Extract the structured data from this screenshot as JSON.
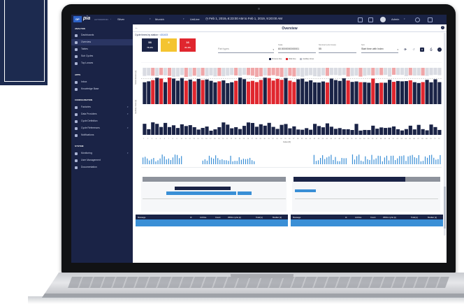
{
  "topbar": {
    "logo_short": "DP",
    "logo_brand": "pia",
    "logo_sub": "AUTOMATION",
    "filters": [
      {
        "value": "Silver"
      },
      {
        "value": "Munich"
      },
      {
        "value": "UniLine"
      }
    ],
    "date_range": "Feb 1, 2019, 6:23:00 AM to Feb 1, 2019, 9:20:00 AM",
    "user": "Admin"
  },
  "sidebar": {
    "sections": [
      {
        "title": "ANALYSIS",
        "items": [
          {
            "label": "Dashboards"
          },
          {
            "label": "Overview"
          },
          {
            "label": "Tables"
          },
          {
            "label": "Sub Cycles"
          },
          {
            "label": "Top Losses"
          }
        ]
      },
      {
        "title": "APPS",
        "items": [
          {
            "label": "Inbox"
          },
          {
            "label": "Knowledge Base"
          }
        ]
      },
      {
        "title": "CONFIGURATION",
        "items": [
          {
            "label": "Factories"
          },
          {
            "label": "Data Providers"
          },
          {
            "label": "Cycle Definition"
          },
          {
            "label": "Cycle References"
          },
          {
            "label": "Notifications"
          }
        ]
      },
      {
        "title": "SYSTEM",
        "items": [
          {
            "label": "Monitoring"
          },
          {
            "label": "User Management"
          },
          {
            "label": "Documentation"
          }
        ]
      }
    ]
  },
  "page": {
    "title": "Overview",
    "breadcrumb_prefix": "Cycle times by station",
    "breadcrumb_link": "401403",
    "kpis": [
      {
        "count": "58",
        "pct": "76.4%",
        "color": "#1a2346"
      },
      {
        "count": "8",
        "pct": "",
        "color": "#f4c430"
      },
      {
        "count": "16",
        "pct": "21.4%",
        "color": "#e0262e"
      }
    ],
    "fields": {
      "part_types_placeholder": "Part types",
      "scale_label": "Scale",
      "scale_value": "60.5000000000001",
      "nominal_label": "Nominal cycle time[s]",
      "nominal_value": "55",
      "sort_label": "Sort",
      "sort_value": "Start time with Index"
    },
    "legend": [
      "Process time",
      "Wait time",
      "Auxiliary times"
    ],
    "y_label_1": "Serial duration [s]",
    "y_label_2": "Auxiliary times [s]",
    "x_axis_label": "Index [#]",
    "tables": [
      {
        "headers": [
          "Message",
          "Id",
          "Archive",
          "Count",
          "Within cycle [s]",
          "Total [s]",
          "Median [s]"
        ]
      },
      {
        "headers": [
          "Message",
          "Id",
          "Archive",
          "Count",
          "Within cycle [s]",
          "Total [s]",
          "Median [s]"
        ]
      }
    ]
  },
  "colors": {
    "navy": "#1a2346",
    "red": "#e0262e",
    "light_red": "#f0a6a8",
    "grey": "#b9bcc7",
    "blue": "#3a8fd6"
  }
}
